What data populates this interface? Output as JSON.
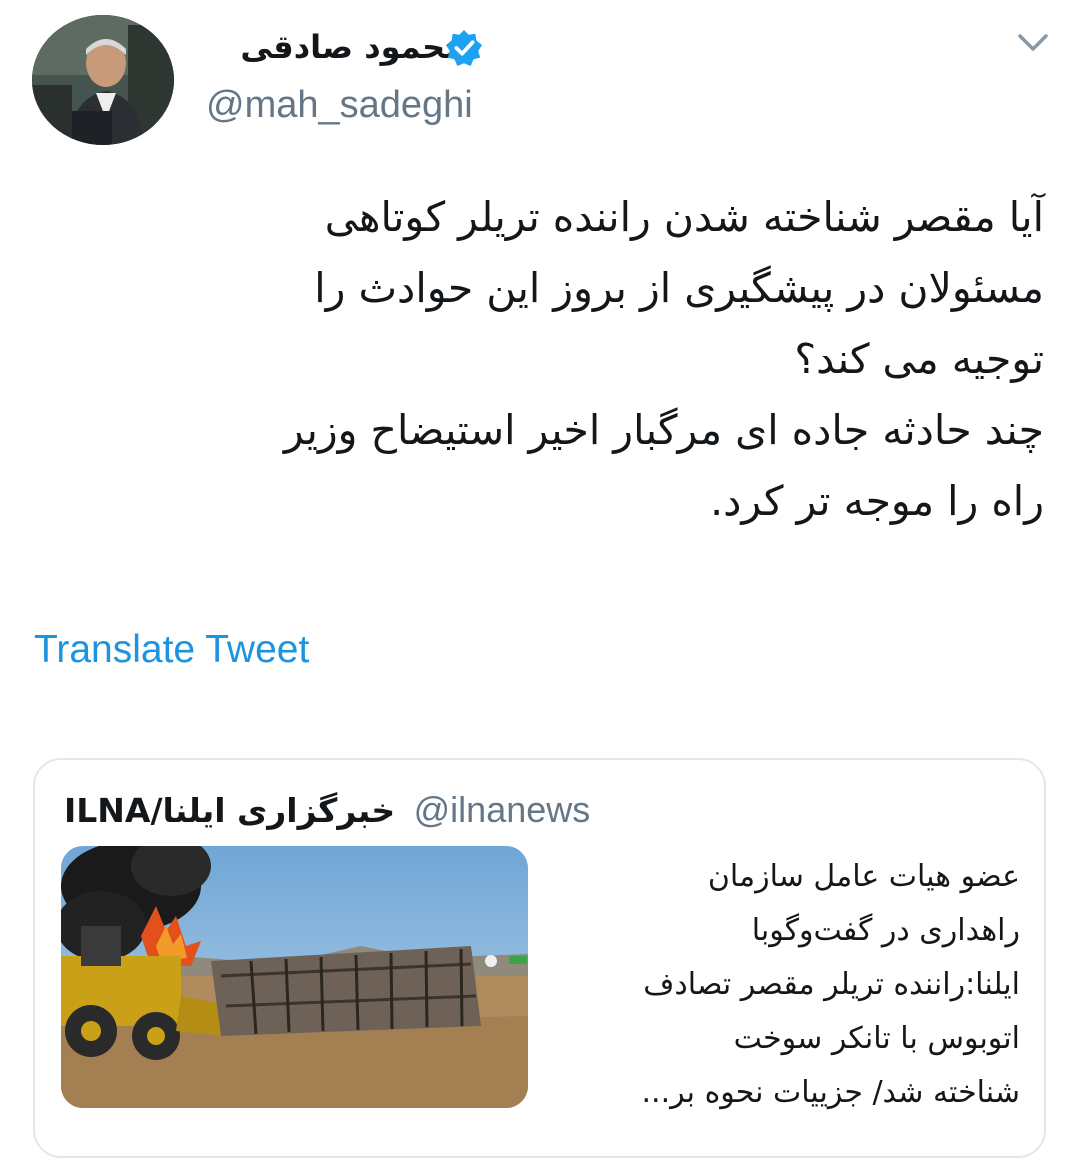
{
  "author": {
    "display_name": "محمود صادقی",
    "handle": "@mah_sadeghi",
    "verified": true,
    "avatar_icon": "profile-photo"
  },
  "menu_icon": "chevron-down-icon",
  "tweet": {
    "lines": [
      "آیا مقصر شناخته شدن راننده تریلر کوتاهی",
      "مسئولان در پیشگیری از بروز این حوادث را",
      "توجیه می کند؟",
      "چند حادثه جاده ای مرگبار اخیر استیضاح وزیر",
      "راه را موجه تر کرد."
    ]
  },
  "translate_label": "Translate Tweet",
  "quoted": {
    "name": "ILNA/خبرگزاری ایلنا",
    "handle": "@ilnanews",
    "image_icon": "news-photo-burned-bus",
    "lines": [
      "عضو هیات عامل سازمان",
      "راهداری در گفت‌وگوبا",
      "ایلنا:راننده تریلر مقصر تصادف",
      "اتوبوس با تانکر سوخت",
      "شناخته شد/ جزییات نحوه بر..."
    ]
  },
  "colors": {
    "link": "#1b95e0",
    "verified": "#1da1f2",
    "secondary_text": "#657786",
    "border": "#e1e8ed"
  }
}
